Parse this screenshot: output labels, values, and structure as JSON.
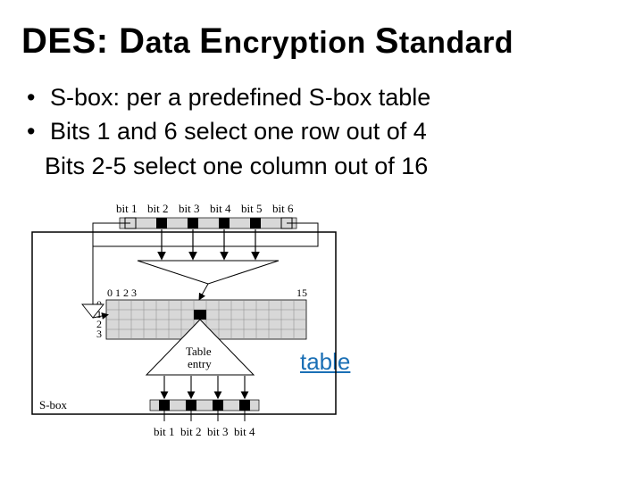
{
  "title": {
    "part1": "DES: D",
    "part2": "ata ",
    "part3": "E",
    "part4": "ncryption ",
    "part5": "S",
    "part6": "tandard"
  },
  "bullets": {
    "b1": "S-box: per a predefined S-box table",
    "b2": "Bits 1 and 6 select one row out of 4",
    "b2sub": "Bits 2-5 select one column out of 16"
  },
  "link_text": "table",
  "diagram": {
    "top_bits": [
      "bit 1",
      "bit 2",
      "bit 3",
      "bit 4",
      "bit 5",
      "bit 6"
    ],
    "bottom_bits": [
      "bit 1",
      "bit 2",
      "bit 3",
      "bit 4"
    ],
    "row_labels": [
      "0",
      "1",
      "2",
      "3"
    ],
    "col_first": "0 1 2 3",
    "col_last": "15",
    "sbox_caption": "S-box",
    "entry_caption_l1": "Table",
    "entry_caption_l2": "entry"
  }
}
